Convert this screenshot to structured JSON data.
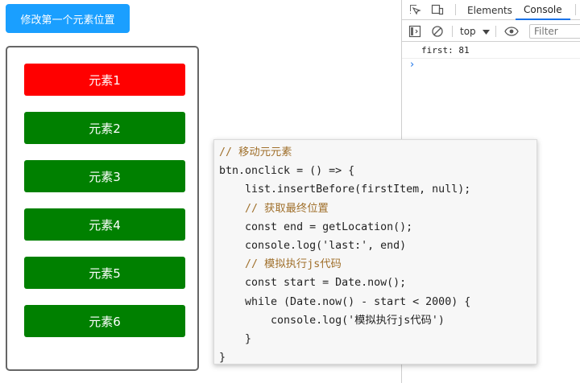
{
  "page": {
    "modify_button_label": "修改第一个元素位置",
    "items": [
      {
        "label": "元素1",
        "color": "#ff0000"
      },
      {
        "label": "元素2",
        "color": "#008000"
      },
      {
        "label": "元素3",
        "color": "#008000"
      },
      {
        "label": "元素4",
        "color": "#008000"
      },
      {
        "label": "元素5",
        "color": "#008000"
      },
      {
        "label": "元素6",
        "color": "#008000"
      }
    ]
  },
  "devtools": {
    "tabs": [
      "Elements",
      "Console"
    ],
    "active_tab": "Console",
    "context": "top",
    "filter_placeholder": "Filter",
    "console_lines": [
      "first: 81"
    ],
    "prompt": "›",
    "accent_color": "#1a73e8"
  },
  "code_popup": {
    "lines": [
      "// 移动元元素",
      "btn.onclick = () => {",
      "    list.insertBefore(firstItem, null);",
      "    // 获取最终位置",
      "    const end = getLocation();",
      "    console.log('last:', end)",
      "    // 模拟执行js代码",
      "    const start = Date.now();",
      "    while (Date.now() - start < 2000) {",
      "        console.log('模拟执行js代码')",
      "    }",
      "}"
    ]
  }
}
